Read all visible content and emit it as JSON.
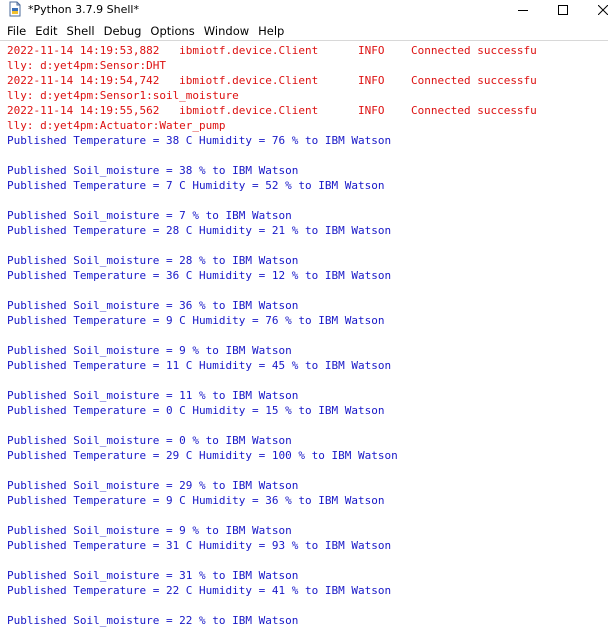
{
  "window": {
    "title": "*Python 3.7.9 Shell*",
    "colors": {
      "stderr": "#dd1111",
      "stdout": "#1818c8"
    }
  },
  "menu": [
    "File",
    "Edit",
    "Shell",
    "Debug",
    "Options",
    "Window",
    "Help"
  ],
  "console": {
    "lines": [
      {
        "type": "stderr",
        "text": "2022-11-14 14:19:53,882   ibmiotf.device.Client      INFO    Connected successfu"
      },
      {
        "type": "stderr",
        "text": "lly: d:yet4pm:Sensor:DHT"
      },
      {
        "type": "stderr",
        "text": "2022-11-14 14:19:54,742   ibmiotf.device.Client      INFO    Connected successfu"
      },
      {
        "type": "stderr",
        "text": "lly: d:yet4pm:Sensor1:soil_moisture"
      },
      {
        "type": "stderr",
        "text": "2022-11-14 14:19:55,562   ibmiotf.device.Client      INFO    Connected successfu"
      },
      {
        "type": "stderr",
        "text": "lly: d:yet4pm:Actuator:Water_pump"
      },
      {
        "type": "stdout",
        "text": "Published Temperature = 38 C Humidity = 76 % to IBM Watson"
      },
      {
        "type": "stdout",
        "text": ""
      },
      {
        "type": "stdout",
        "text": "Published Soil_moisture = 38 % to IBM Watson"
      },
      {
        "type": "stdout",
        "text": "Published Temperature = 7 C Humidity = 52 % to IBM Watson"
      },
      {
        "type": "stdout",
        "text": ""
      },
      {
        "type": "stdout",
        "text": "Published Soil_moisture = 7 % to IBM Watson"
      },
      {
        "type": "stdout",
        "text": "Published Temperature = 28 C Humidity = 21 % to IBM Watson"
      },
      {
        "type": "stdout",
        "text": ""
      },
      {
        "type": "stdout",
        "text": "Published Soil_moisture = 28 % to IBM Watson"
      },
      {
        "type": "stdout",
        "text": "Published Temperature = 36 C Humidity = 12 % to IBM Watson"
      },
      {
        "type": "stdout",
        "text": ""
      },
      {
        "type": "stdout",
        "text": "Published Soil_moisture = 36 % to IBM Watson"
      },
      {
        "type": "stdout",
        "text": "Published Temperature = 9 C Humidity = 76 % to IBM Watson"
      },
      {
        "type": "stdout",
        "text": ""
      },
      {
        "type": "stdout",
        "text": "Published Soil_moisture = 9 % to IBM Watson"
      },
      {
        "type": "stdout",
        "text": "Published Temperature = 11 C Humidity = 45 % to IBM Watson"
      },
      {
        "type": "stdout",
        "text": ""
      },
      {
        "type": "stdout",
        "text": "Published Soil_moisture = 11 % to IBM Watson"
      },
      {
        "type": "stdout",
        "text": "Published Temperature = 0 C Humidity = 15 % to IBM Watson"
      },
      {
        "type": "stdout",
        "text": ""
      },
      {
        "type": "stdout",
        "text": "Published Soil_moisture = 0 % to IBM Watson"
      },
      {
        "type": "stdout",
        "text": "Published Temperature = 29 C Humidity = 100 % to IBM Watson"
      },
      {
        "type": "stdout",
        "text": ""
      },
      {
        "type": "stdout",
        "text": "Published Soil_moisture = 29 % to IBM Watson"
      },
      {
        "type": "stdout",
        "text": "Published Temperature = 9 C Humidity = 36 % to IBM Watson"
      },
      {
        "type": "stdout",
        "text": ""
      },
      {
        "type": "stdout",
        "text": "Published Soil_moisture = 9 % to IBM Watson"
      },
      {
        "type": "stdout",
        "text": "Published Temperature = 31 C Humidity = 93 % to IBM Watson"
      },
      {
        "type": "stdout",
        "text": ""
      },
      {
        "type": "stdout",
        "text": "Published Soil_moisture = 31 % to IBM Watson"
      },
      {
        "type": "stdout",
        "text": "Published Temperature = 22 C Humidity = 41 % to IBM Watson"
      },
      {
        "type": "stdout",
        "text": ""
      },
      {
        "type": "stdout",
        "text": "Published Soil_moisture = 22 % to IBM Watson"
      }
    ]
  }
}
